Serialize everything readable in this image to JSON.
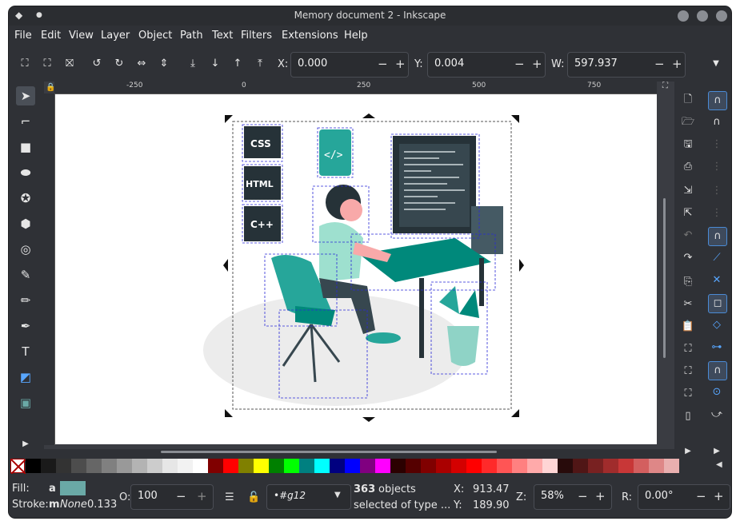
{
  "window": {
    "title": "Memory document 2 - Inkscape"
  },
  "menu": [
    "File",
    "Edit",
    "View",
    "Layer",
    "Object",
    "Path",
    "Text",
    "Filters",
    "Extensions",
    "Help"
  ],
  "toolbar": {
    "x_label": "X:",
    "x_value": "0.000",
    "y_label": "Y:",
    "y_value": "0.004",
    "w_label": "W:",
    "w_value": "597.937",
    "minus": "−",
    "plus": "+"
  },
  "ruler": {
    "ticks": [
      "-250",
      "0",
      "250",
      "500",
      "750"
    ]
  },
  "artwork": {
    "badges": [
      "CSS",
      "HTML",
      "C++"
    ],
    "code_icon": "</>"
  },
  "status": {
    "fill_label": "Fill:",
    "fill_value": "a",
    "stroke_label": "Stroke:",
    "stroke_m": "m",
    "stroke_value": "None",
    "stroke_width": "0.133",
    "opacity_label": "O:",
    "opacity_value": "100",
    "layer_value": "•#g12",
    "objects_count": "363",
    "objects_text": "objects",
    "selected_text": "selected of type ...",
    "x_label": "X:",
    "x_value": "913.47",
    "y_label": "Y:",
    "y_value": "189.90",
    "z_label": "Z:",
    "z_value": "58%",
    "r_label": "R:",
    "r_value": "0.00°"
  },
  "colors": {
    "fill_swatch": "#6aa9a6",
    "palette": [
      "#000000",
      "#1a1a1a",
      "#333333",
      "#4d4d4d",
      "#666666",
      "#808080",
      "#999999",
      "#b3b3b3",
      "#cccccc",
      "#e6e6e6",
      "#f2f2f2",
      "#ffffff",
      "#800000",
      "#ff0000",
      "#808000",
      "#ffff00",
      "#008000",
      "#00ff00",
      "#008080",
      "#00ffff",
      "#000080",
      "#0000ff",
      "#800080",
      "#ff00ff",
      "#2b0000",
      "#550000",
      "#800000",
      "#aa0000",
      "#d40000",
      "#ff0000",
      "#ff2a2a",
      "#ff5555",
      "#ff8080",
      "#ffaaaa",
      "#ffd5d5",
      "#280b0b",
      "#501616",
      "#782121",
      "#a02c2c",
      "#c83737",
      "#d35f5f",
      "#de8787",
      "#e9afaf"
    ]
  }
}
